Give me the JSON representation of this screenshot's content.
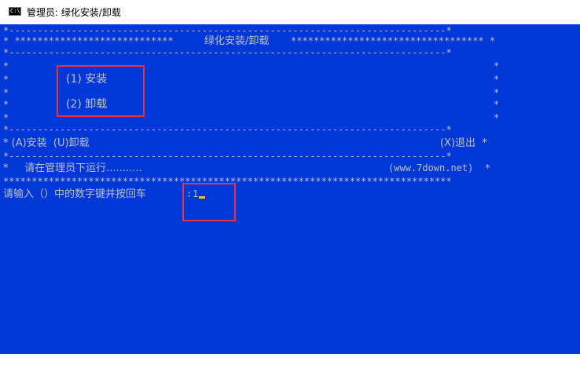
{
  "window": {
    "title": "管理员: 绿化安装/卸载",
    "icon": "cmd-icon",
    "icon_text": "C:\\"
  },
  "console": {
    "background": "#0037d8",
    "text_color": "#c0c0c0",
    "border_top": "*-----------------------------------------------------------------------------*",
    "banner_left": "* ****************************",
    "banner_title": "绿化安装/卸载",
    "banner_right": "********************************** *",
    "border_mid": "*-----------------------------------------------------------------------------*",
    "star": "*",
    "menu": {
      "install": "(1) 安装",
      "uninstall": "(2) 卸载"
    },
    "border_mid2": "*-----------------------------------------------------------------------------*",
    "shortcut_install": "* (A)安装  (U)卸载",
    "shortcut_exit": "(X)退出  *",
    "border_mid3": "*-----------------------------------------------------------------------------*",
    "run_hint": "*     请在管理员下运行...........",
    "site": "(www.7down.net)  *",
    "border_bottom": "*******************************************************************************",
    "prompt": "请输入（）中的数字键并按回车",
    "prompt_colon": ":",
    "input_value": "1"
  },
  "highlight_color": "#e8323c"
}
